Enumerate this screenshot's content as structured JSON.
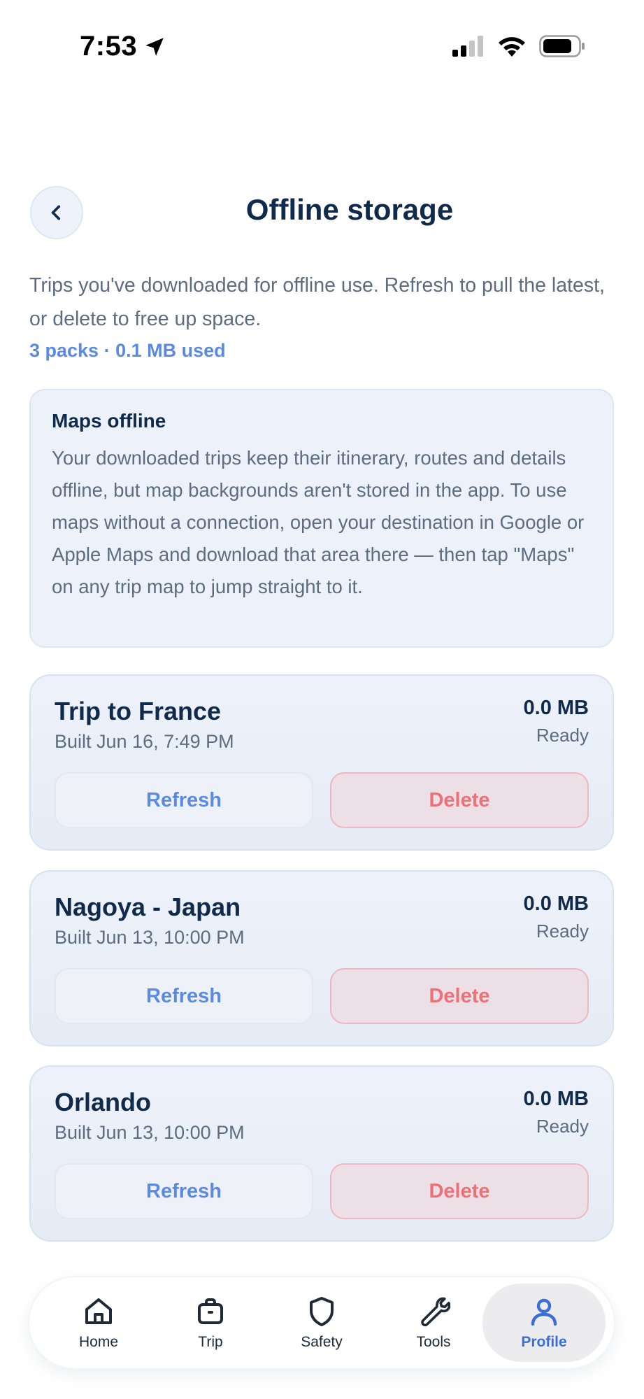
{
  "status_bar": {
    "time": "7:53",
    "icons": [
      "location-arrow-icon",
      "cellular-signal-icon",
      "wifi-icon",
      "battery-icon"
    ]
  },
  "header": {
    "back_icon": "chevron-left-icon",
    "title": "Offline storage"
  },
  "intro": {
    "description": "Trips you've downloaded for offline use. Refresh to pull the latest, or delete to free up space.",
    "usage": "3 packs · 0.1 MB used"
  },
  "info_card": {
    "title": "Maps offline",
    "text": "Your downloaded trips keep their itinerary, routes and details offline, but map backgrounds aren't stored in the app. To use maps without a connection, open your destination in Google or Apple Maps and download that area there — then tap \"Maps\" on any trip map to jump straight to it."
  },
  "trips": [
    {
      "name": "Trip to France",
      "built": "Built Jun 16, 7:49 PM",
      "size": "0.0 MB",
      "status": "Ready",
      "refresh_label": "Refresh",
      "delete_label": "Delete"
    },
    {
      "name": "Nagoya - Japan",
      "built": "Built Jun 13, 10:00 PM",
      "size": "0.0 MB",
      "status": "Ready",
      "refresh_label": "Refresh",
      "delete_label": "Delete"
    },
    {
      "name": "Orlando",
      "built": "Built Jun 13, 10:00 PM",
      "size": "0.0 MB",
      "status": "Ready",
      "refresh_label": "Refresh",
      "delete_label": "Delete"
    }
  ],
  "bottom_nav": {
    "active": "Profile",
    "items": [
      {
        "label": "Home",
        "icon": "home-icon"
      },
      {
        "label": "Trip",
        "icon": "briefcase-icon"
      },
      {
        "label": "Safety",
        "icon": "shield-icon"
      },
      {
        "label": "Tools",
        "icon": "wrench-icon"
      },
      {
        "label": "Profile",
        "icon": "user-icon"
      }
    ]
  },
  "colors": {
    "accent": "#5b8be0",
    "active_nav": "#3b6fd6",
    "danger": "#ee7077",
    "title": "#0f2a4a",
    "muted": "#5d6c80"
  }
}
